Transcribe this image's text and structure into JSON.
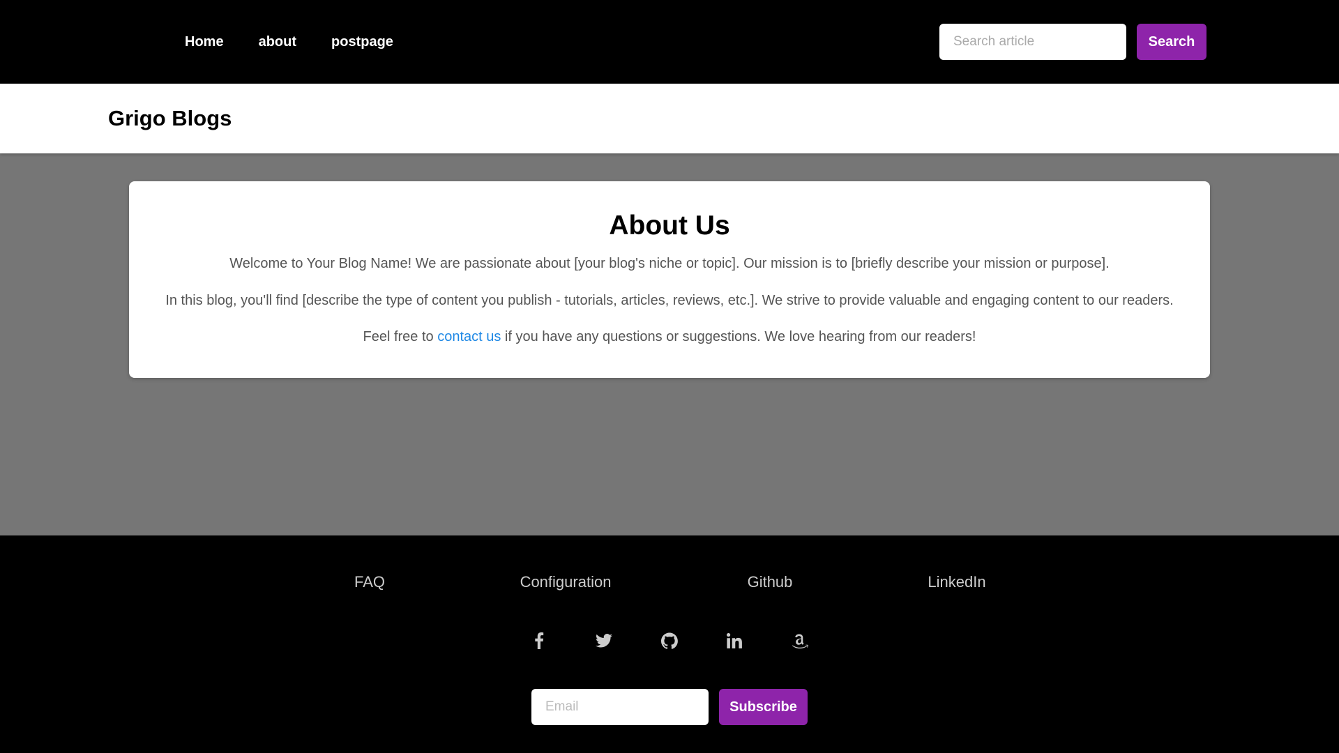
{
  "nav": {
    "links": [
      "Home",
      "about",
      "postpage"
    ],
    "search_placeholder": "Search article",
    "search_button": "Search"
  },
  "brand": {
    "title": "Grigo Blogs"
  },
  "about": {
    "title": "About Us",
    "paragraph1": "Welcome to Your Blog Name! We are passionate about [your blog's niche or topic]. Our mission is to [briefly describe your mission or purpose].",
    "paragraph2": "In this blog, you'll find [describe the type of content you publish - tutorials, articles, reviews, etc.]. We strive to provide valuable and engaging content to our readers.",
    "paragraph3_before": "Feel free to ",
    "paragraph3_link": "contact us",
    "paragraph3_after": " if you have any questions or suggestions. We love hearing from our readers!"
  },
  "footer": {
    "links": [
      "FAQ",
      "Configuration",
      "Github",
      "LinkedIn"
    ],
    "socials": [
      "facebook-icon",
      "twitter-icon",
      "github-icon",
      "linkedin-icon",
      "amazon-icon"
    ],
    "email_placeholder": "Email",
    "subscribe_button": "Subscribe"
  },
  "colors": {
    "accent": "#8e24aa",
    "link": "#1e88e5",
    "nav_background": "#000000",
    "page_background": "#767676"
  }
}
